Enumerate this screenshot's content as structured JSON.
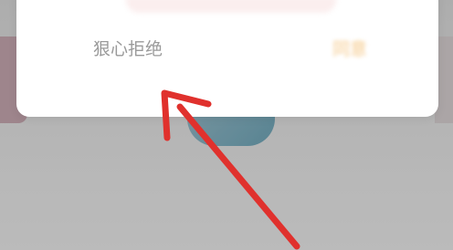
{
  "dialog": {
    "reject_label": "狠心拒绝",
    "accept_label": "同意"
  },
  "background": {
    "labels": [
      "",
      "",
      ""
    ]
  },
  "colors": {
    "annotation_arrow": "#e0312d",
    "reject_text": "#9a9a9a",
    "accept_text": "#f5c98a"
  },
  "icons": {
    "annotation": "arrow-pointer-icon"
  }
}
